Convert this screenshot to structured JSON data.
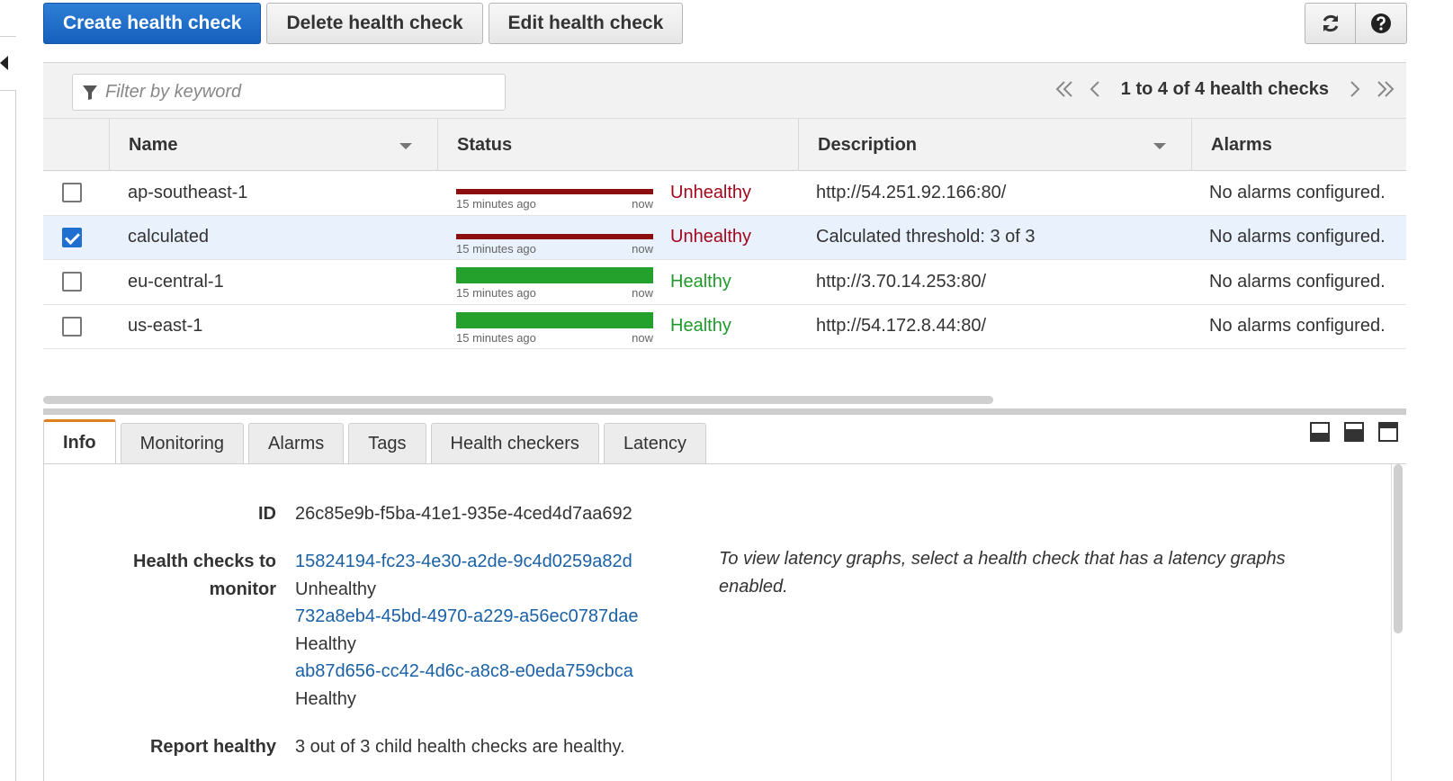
{
  "toolbar": {
    "create_label": "Create health check",
    "delete_label": "Delete health check",
    "edit_label": "Edit health check"
  },
  "filter": {
    "placeholder": "Filter by keyword"
  },
  "pager": {
    "text": "1 to 4 of 4 health checks"
  },
  "columns": {
    "name": "Name",
    "status": "Status",
    "description": "Description",
    "alarms": "Alarms"
  },
  "rows": [
    {
      "name": "ap-southeast-1",
      "selected": false,
      "status": "Unhealthy",
      "graph_left": "15 minutes ago",
      "graph_right": "now",
      "description": "http://54.251.92.166:80/",
      "alarms": "No alarms configured."
    },
    {
      "name": "calculated",
      "selected": true,
      "status": "Unhealthy",
      "graph_left": "15 minutes ago",
      "graph_right": "now",
      "description": "Calculated threshold: 3 of 3",
      "alarms": "No alarms configured."
    },
    {
      "name": "eu-central-1",
      "selected": false,
      "status": "Healthy",
      "graph_left": "15 minutes ago",
      "graph_right": "now",
      "description": "http://3.70.14.253:80/",
      "alarms": "No alarms configured."
    },
    {
      "name": "us-east-1",
      "selected": false,
      "status": "Healthy",
      "graph_left": "15 minutes ago",
      "graph_right": "now",
      "description": "http://54.172.8.44:80/",
      "alarms": "No alarms configured."
    }
  ],
  "tabs": [
    "Info",
    "Monitoring",
    "Alarms",
    "Tags",
    "Health checkers",
    "Latency"
  ],
  "info": {
    "id_label": "ID",
    "id_value": "26c85e9b-f5ba-41e1-935e-4ced4d7aa692",
    "monitor_label_1": "Health checks to",
    "monitor_label_2": "monitor",
    "children": [
      {
        "id": "15824194-fc23-4e30-a2de-9c4d0259a82d",
        "status": "Unhealthy"
      },
      {
        "id": "732a8eb4-45bd-4970-a229-a56ec0787dae",
        "status": "Healthy"
      },
      {
        "id": "ab87d656-cc42-4d6c-a8c8-e0eda759cbca",
        "status": "Healthy"
      }
    ],
    "report_label": "Report healthy",
    "report_value": "3 out of 3 child health checks are healthy.",
    "latency_note": "To view latency graphs, select a health check that has a latency graphs enabled."
  },
  "colors": {
    "primary": "#1560bd",
    "unhealthy": "#a3071d",
    "healthy": "#1f9a2a",
    "link": "#1a61a6",
    "active_tab": "#e07f1f"
  }
}
